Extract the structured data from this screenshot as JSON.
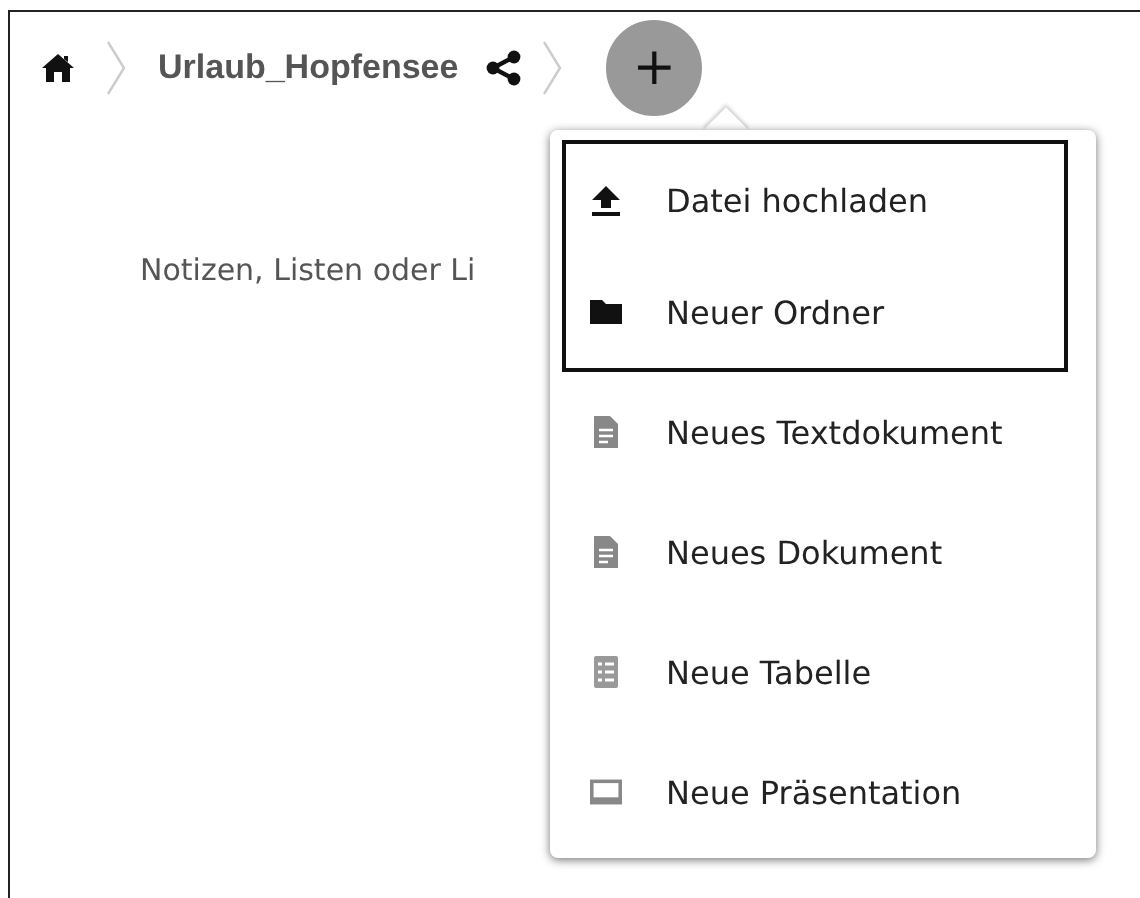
{
  "breadcrumb": {
    "folder": "Urlaub_Hopfensee"
  },
  "add_button": {
    "label": "+",
    "expanded": true
  },
  "hint": "Notizen, Listen oder Li",
  "menu": {
    "items": [
      {
        "label": "Datei hochladen",
        "kind": "upload",
        "highlighted": true
      },
      {
        "label": "Neuer Ordner",
        "kind": "folder",
        "highlighted": true
      },
      {
        "label": "Neues Textdokument",
        "kind": "text",
        "highlighted": false
      },
      {
        "label": "Neues Dokument",
        "kind": "document",
        "highlighted": false
      },
      {
        "label": "Neue Tabelle",
        "kind": "spreadsheet",
        "highlighted": false
      },
      {
        "label": "Neue Präsentation",
        "kind": "presentation",
        "highlighted": false
      }
    ]
  }
}
